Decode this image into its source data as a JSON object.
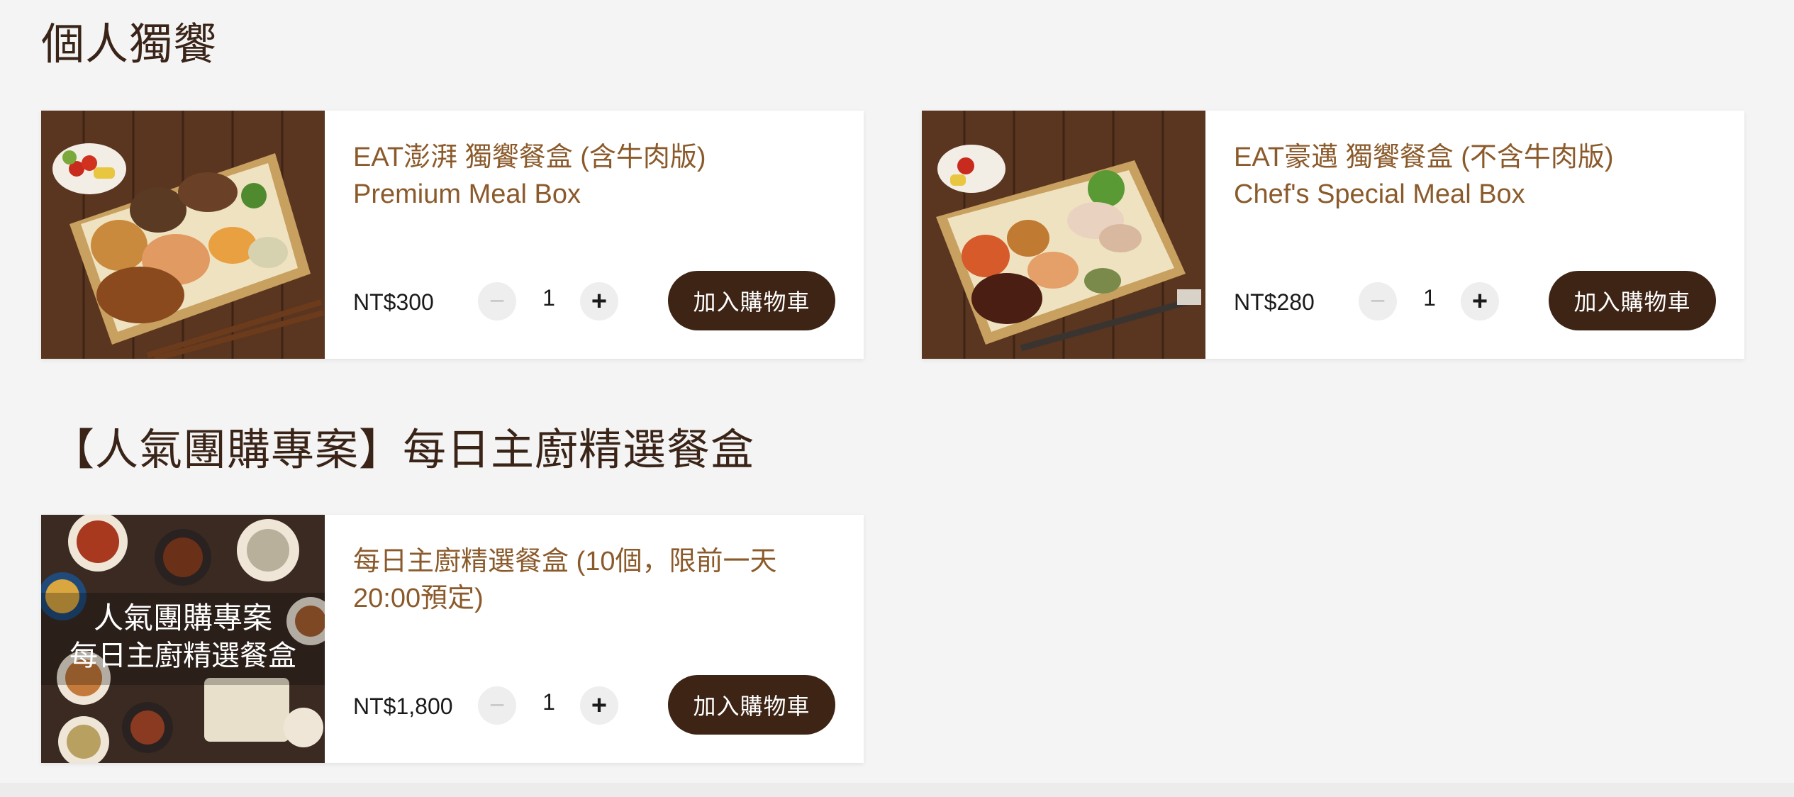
{
  "sections": [
    {
      "title": "個人獨饗",
      "items": [
        {
          "name_line1": "EAT澎湃 獨饗餐盒 (含牛肉版)",
          "name_line2": "Premium Meal Box",
          "price": "NT$300",
          "quantity": "1",
          "add_label": "加入購物車"
        },
        {
          "name_line1": "EAT豪邁 獨饗餐盒 (不含牛肉版)",
          "name_line2": "Chef's Special Meal Box",
          "price": "NT$280",
          "quantity": "1",
          "add_label": "加入購物車"
        }
      ]
    },
    {
      "title": "【人氣團購專案】每日主廚精選餐盒",
      "items": [
        {
          "name_line1": "每日主廚精選餐盒 (10個，限前一天",
          "name_line2": "20:00預定)",
          "price": "NT$1,800",
          "quantity": "1",
          "add_label": "加入購物車",
          "image_overlay": [
            "人氣團購專案",
            "每日主廚精選餐盒"
          ]
        }
      ]
    }
  ],
  "icons": {
    "minus": "−",
    "plus": "+"
  },
  "colors": {
    "accent_title": "#8b5a2b",
    "button_bg": "#3d2415",
    "heading": "#3a2418",
    "page_bg": "#f4f4f4"
  }
}
